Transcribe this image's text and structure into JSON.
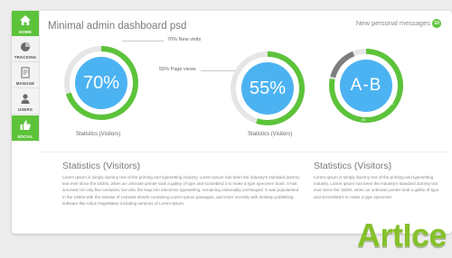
{
  "header": {
    "title": "Minimal admin dashboard psd",
    "messages_label": "New personal messages",
    "messages_count": "10"
  },
  "sidebar": {
    "items": [
      {
        "label": "HOME",
        "icon": "home-icon"
      },
      {
        "label": "TRACKING",
        "icon": "pie-chart-icon"
      },
      {
        "label": "MANAGE",
        "icon": "document-icon"
      },
      {
        "label": "USERS",
        "icon": "user-icon"
      },
      {
        "label": "SOCIAL",
        "icon": "thumbs-up-icon"
      }
    ]
  },
  "gauges": [
    {
      "value_text": "70%",
      "fraction": 0.7,
      "annotation": "70%  New visits",
      "caption": "Statistics (Visitors)"
    },
    {
      "value_text": "55%",
      "fraction": 0.55,
      "annotation": "55%  Page views",
      "caption": "Statistics (Visitors)"
    },
    {
      "value_text": "A-B",
      "fraction_a": 0.78,
      "fraction_b": 0.15,
      "label_a": "80",
      "label_b": "20",
      "caption": ""
    }
  ],
  "sections": [
    {
      "heading": "Statistics (Visitors)",
      "body": "Lorem Ipsum is simply dummy text of the printing and typesetting industry. Lorem Ipsum has been the industry's standard dummy text ever since the 1500s, when an unknown printer took a galley of type and scrambled it to make a type specimen book. It has survived not only five centuries, but also the leap into electronic typesetting, remaining essentially unchanged. It was popularised in the 1960s with the release of Letraset sheets containing Lorem Ipsum passages, and more recently with desktop publishing software like Aldus PageMaker including versions of Lorem Ipsum."
    },
    {
      "heading": "Statistics (Visitors)",
      "body": "Lorem Ipsum is simply dummy text of the printing and typesetting industry. Lorem Ipsum has been the industry's standard dummy text ever since the 1500s, when an unknown printer took a galley of type and scrambled it to make a type specimen"
    }
  ],
  "watermark": "ArtIce",
  "colors": {
    "accent_green": "#5cc33a",
    "gauge_blue": "#4cb3f2",
    "track_gray": "#e6e6e6",
    "dark_gray": "#7d7d7d"
  }
}
